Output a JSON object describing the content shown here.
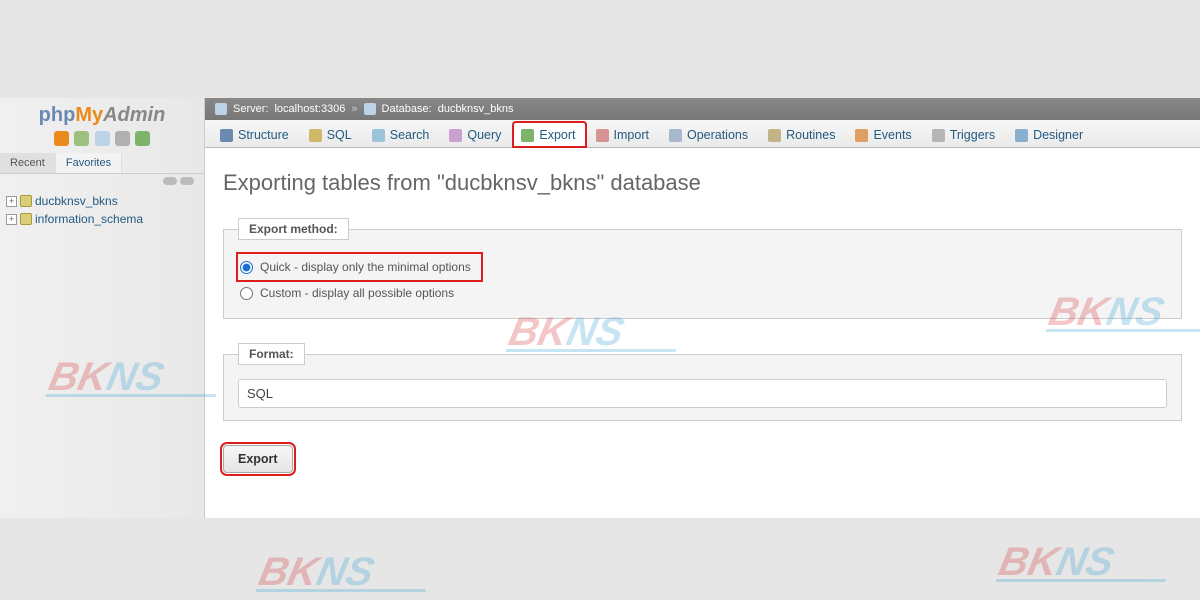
{
  "logo": {
    "p1": "php",
    "p2": "My",
    "p3": "Admin"
  },
  "sidebar_tabs": {
    "recent": "Recent",
    "favorites": "Favorites"
  },
  "tree": {
    "db1": "ducbknsv_bkns",
    "db2": "information_schema"
  },
  "breadcrumb": {
    "server_label": "Server:",
    "server_value": "localhost:3306",
    "database_label": "Database:",
    "database_value": "ducbknsv_bkns"
  },
  "tabs": {
    "structure": "Structure",
    "sql": "SQL",
    "search": "Search",
    "query": "Query",
    "export": "Export",
    "import": "Import",
    "operations": "Operations",
    "routines": "Routines",
    "events": "Events",
    "triggers": "Triggers",
    "designer": "Designer"
  },
  "page_title": "Exporting tables from \"ducbknsv_bkns\" database",
  "export_method": {
    "legend": "Export method:",
    "quick": "Quick - display only the minimal options",
    "custom": "Custom - display all possible options"
  },
  "format": {
    "legend": "Format:",
    "selected": "SQL"
  },
  "export_button": "Export",
  "watermark": {
    "b": "BK",
    "k": "NS"
  }
}
